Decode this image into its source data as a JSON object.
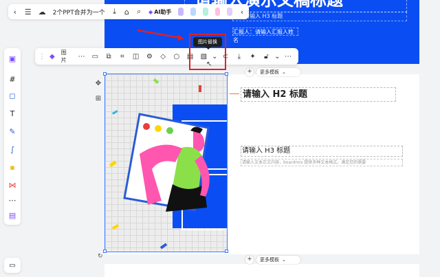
{
  "topbar": {
    "doc_title": "2个PPT合并为一个",
    "ai_label": "AI助手",
    "icons": [
      "chevron-left-icon",
      "menu-icon",
      "cloud-icon",
      "download-icon",
      "tag-icon",
      "search-icon"
    ]
  },
  "slide_top": {
    "title": "请输入演示文稿标题",
    "h3_label": "请输入 H3 标题",
    "reporter": "汇报人：请输入汇报人姓名",
    "bg_color": "#0a4ef3"
  },
  "float_toolbar": {
    "image_label": "图片",
    "tooltip": "图片替换"
  },
  "more_templates": "更多模板",
  "slide_main": {
    "h2": "请输入 H2 标题",
    "h3": "请输入 H3 标题",
    "body": "请输入文本正文内容，boardmix 提供多种文本格式，满足您的需要"
  },
  "colors": {
    "accent_blue": "#0a4ef3",
    "highlight_red": "#e02020",
    "selection": "#3b7bff"
  }
}
